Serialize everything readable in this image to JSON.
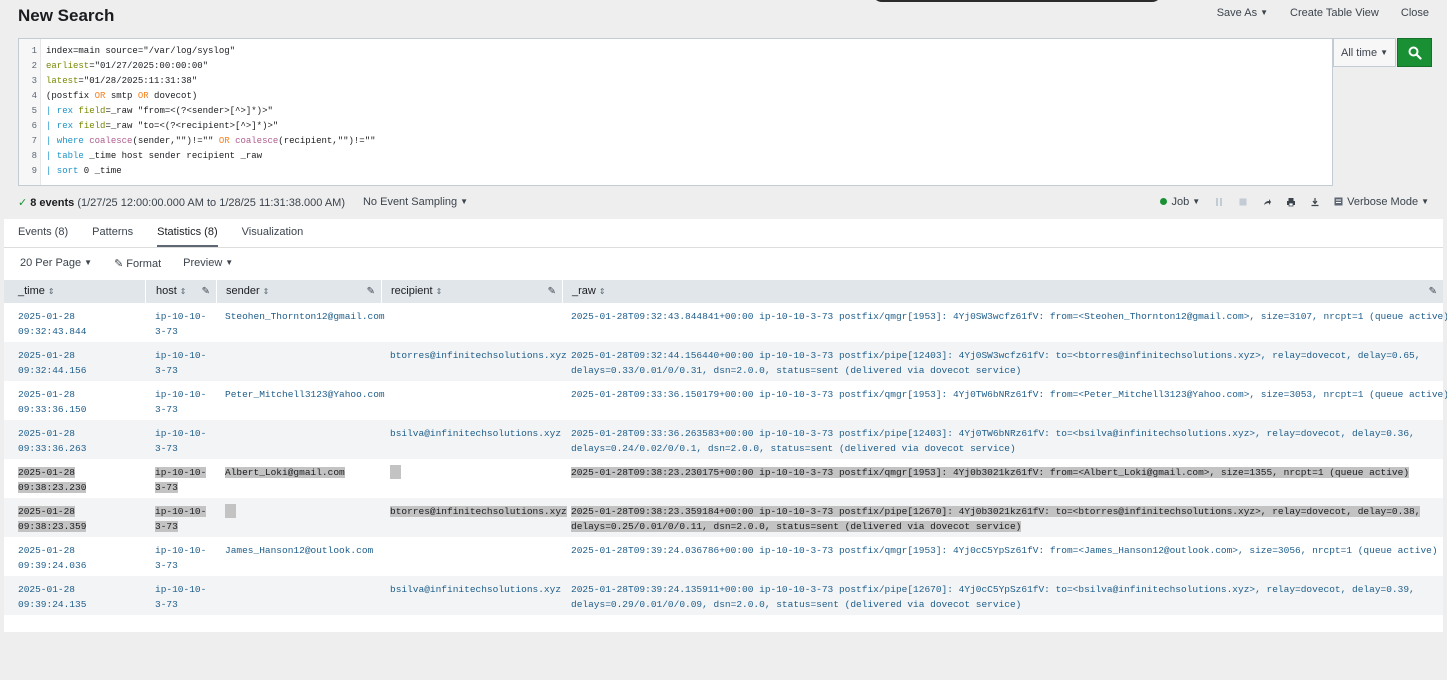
{
  "header": {
    "title": "New Search",
    "actions": [
      "Save As",
      "Create Table View",
      "Close"
    ]
  },
  "search": {
    "lines": [
      {
        "n": "1",
        "text": "index=main source=\"/var/log/syslog\""
      },
      {
        "n": "2",
        "text": "earliest=\"01/27/2025:00:00:00\""
      },
      {
        "n": "3",
        "text": "latest=\"01/28/2025:11:31:38\""
      },
      {
        "n": "4",
        "text": "(postfix OR smtp OR dovecot)"
      },
      {
        "n": "5",
        "text": "| rex field=_raw \"from=<(?<sender>[^>]*)>\""
      },
      {
        "n": "6",
        "text": "| rex field=_raw \"to=<(?<recipient>[^>]*)>\""
      },
      {
        "n": "7",
        "text": "| where coalesce(sender,\"\")!=\"\" OR coalesce(recipient,\"\")!=\"\""
      },
      {
        "n": "8",
        "text": "| table _time host sender recipient _raw"
      },
      {
        "n": "9",
        "text": "| sort 0 _time"
      }
    ],
    "time_range": "All time"
  },
  "status": {
    "events": "8 events",
    "range": "(1/27/25 12:00:00.000 AM to 1/28/25 11:31:38.000 AM)",
    "sampling": "No Event Sampling",
    "job": "Job",
    "mode": "Verbose Mode"
  },
  "tabs": [
    "Events (8)",
    "Patterns",
    "Statistics (8)",
    "Visualization"
  ],
  "options": {
    "per_page": "20 Per Page",
    "format": "Format",
    "preview": "Preview"
  },
  "table": {
    "columns": [
      "_time",
      "host",
      "sender",
      "recipient",
      "_raw"
    ],
    "rows": [
      {
        "time1": "2025-01-28",
        "time2": "09:32:43.844",
        "host1": "ip-10-10-",
        "host2": "3-73",
        "sender": "Steohen_Thornton12@gmail.com",
        "recipient": "",
        "raw1": "2025-01-28T09:32:43.844841+00:00 ip-10-10-3-73 postfix/qmgr[1953]: 4Yj0SW3wcfz61fV: from=<Steohen_Thornton12@gmail.com>, size=3107, nrcpt=1 (queue active)",
        "raw2": "",
        "highlight": false
      },
      {
        "time1": "2025-01-28",
        "time2": "09:32:44.156",
        "host1": "ip-10-10-",
        "host2": "3-73",
        "sender": "",
        "recipient": "btorres@infinitechsolutions.xyz",
        "raw1": "2025-01-28T09:32:44.156440+00:00 ip-10-10-3-73 postfix/pipe[12403]: 4Yj0SW3wcfz61fV: to=<btorres@infinitechsolutions.xyz>, relay=dovecot, delay=0.65,",
        "raw2": "delays=0.33/0.01/0/0.31, dsn=2.0.0, status=sent (delivered via dovecot service)",
        "highlight": false
      },
      {
        "time1": "2025-01-28",
        "time2": "09:33:36.150",
        "host1": "ip-10-10-",
        "host2": "3-73",
        "sender": "Peter_Mitchell3123@Yahoo.com",
        "recipient": "",
        "raw1": "2025-01-28T09:33:36.150179+00:00 ip-10-10-3-73 postfix/qmgr[1953]: 4Yj0TW6bNRz61fV: from=<Peter_Mitchell3123@Yahoo.com>, size=3053, nrcpt=1 (queue active)",
        "raw2": "",
        "highlight": false
      },
      {
        "time1": "2025-01-28",
        "time2": "09:33:36.263",
        "host1": "ip-10-10-",
        "host2": "3-73",
        "sender": "",
        "recipient": "bsilva@infinitechsolutions.xyz",
        "raw1": "2025-01-28T09:33:36.263583+00:00 ip-10-10-3-73 postfix/pipe[12403]: 4Yj0TW6bNRz61fV: to=<bsilva@infinitechsolutions.xyz>, relay=dovecot, delay=0.36,",
        "raw2": "delays=0.24/0.02/0/0.1, dsn=2.0.0, status=sent (delivered via dovecot service)",
        "highlight": false
      },
      {
        "time1": "2025-01-28",
        "time2": "09:38:23.230",
        "host1": "ip-10-10-",
        "host2": "3-73",
        "sender": "Albert_Loki@gmail.com",
        "recipient": "",
        "raw1": "2025-01-28T09:38:23.230175+00:00 ip-10-10-3-73 postfix/qmgr[1953]: 4Yj0b3021kz61fV: from=<Albert_Loki@gmail.com>, size=1355, nrcpt=1 (queue active)",
        "raw2": "",
        "highlight": true
      },
      {
        "time1": "2025-01-28",
        "time2": "09:38:23.359",
        "host1": "ip-10-10-",
        "host2": "3-73",
        "sender": "",
        "recipient": "btorres@infinitechsolutions.xyz",
        "raw1": "2025-01-28T09:38:23.359184+00:00 ip-10-10-3-73 postfix/pipe[12670]: 4Yj0b3021kz61fV: to=<btorres@infinitechsolutions.xyz>, relay=dovecot, delay=0.38,",
        "raw2": "delays=0.25/0.01/0/0.11, dsn=2.0.0, status=sent (delivered via dovecot service)",
        "highlight": true
      },
      {
        "time1": "2025-01-28",
        "time2": "09:39:24.036",
        "host1": "ip-10-10-",
        "host2": "3-73",
        "sender": "James_Hanson12@outlook.com",
        "recipient": "",
        "raw1": "2025-01-28T09:39:24.036786+00:00 ip-10-10-3-73 postfix/qmgr[1953]: 4Yj0cC5YpSz61fV: from=<James_Hanson12@outlook.com>, size=3056, nrcpt=1 (queue active)",
        "raw2": "",
        "highlight": false
      },
      {
        "time1": "2025-01-28",
        "time2": "09:39:24.135",
        "host1": "ip-10-10-",
        "host2": "3-73",
        "sender": "",
        "recipient": "bsilva@infinitechsolutions.xyz",
        "raw1": "2025-01-28T09:39:24.135911+00:00 ip-10-10-3-73 postfix/pipe[12670]: 4Yj0cC5YpSz61fV: to=<bsilva@infinitechsolutions.xyz>, relay=dovecot, delay=0.39,",
        "raw2": "delays=0.29/0.01/0/0.09, dsn=2.0.0, status=sent (delivered via dovecot service)",
        "highlight": false
      }
    ]
  },
  "colors": {
    "accent_green": "#1a9035",
    "link_blue": "#1e5d8a",
    "header_gray": "#e1e6eb",
    "highlight_gray": "#c3c3c3"
  }
}
